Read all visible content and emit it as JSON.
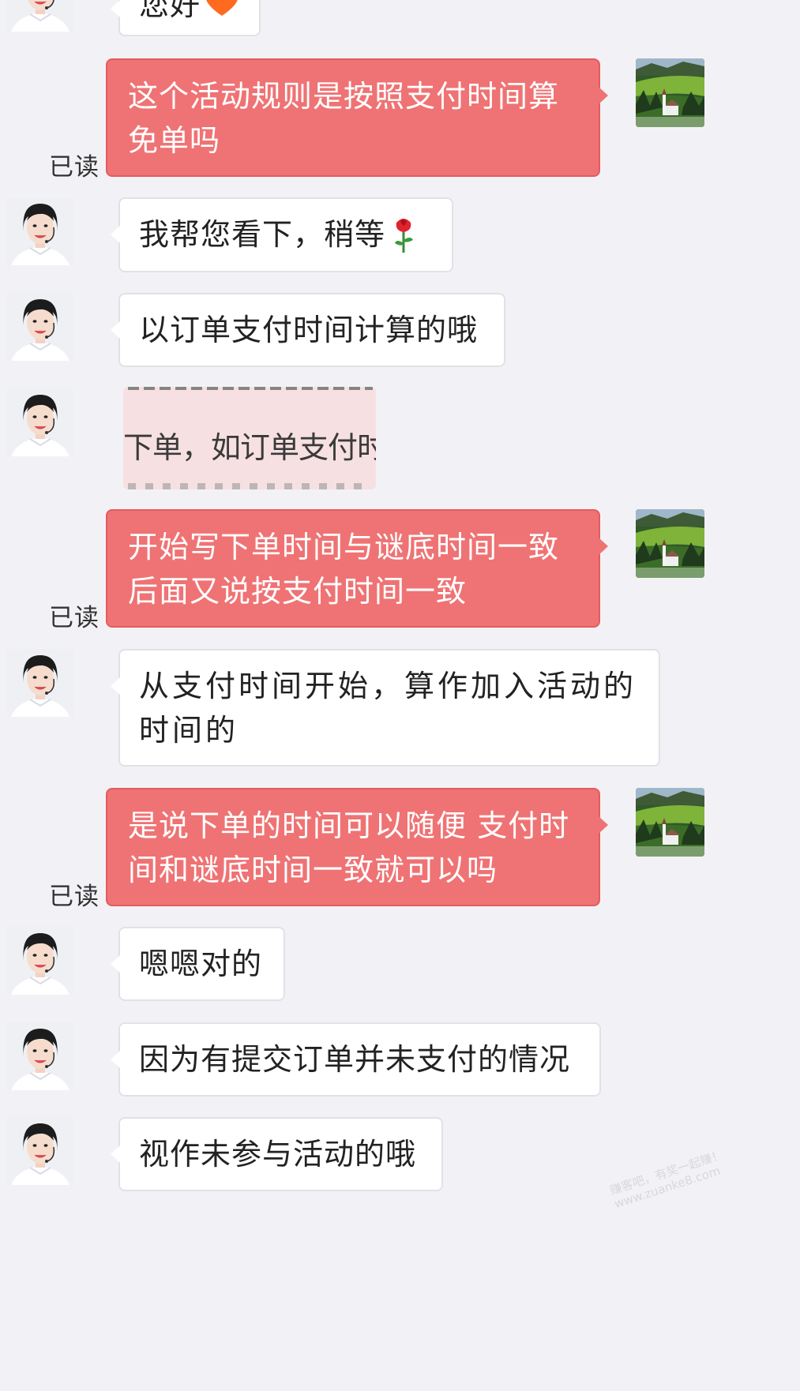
{
  "colors": {
    "background": "#f2f2f6",
    "outgoing_bubble": "#ef7374",
    "incoming_bubble": "#ffffff",
    "heart_emoji": "#ff6a1f"
  },
  "messages": [
    {
      "id": "m0",
      "side": "in",
      "text": "您好",
      "emoji": "orange-heart"
    },
    {
      "id": "m1",
      "side": "out",
      "text": "这个活动规则是按照支付时间算免单吗",
      "status": "已读"
    },
    {
      "id": "m2",
      "side": "in",
      "text": "我帮您看下，稍等",
      "emoji": "rose"
    },
    {
      "id": "m3",
      "side": "in",
      "text": "以订单支付时间计算的哦"
    },
    {
      "id": "m4",
      "side": "in",
      "type": "image",
      "text": "下单，如订单支付时间与"
    },
    {
      "id": "m5",
      "side": "out",
      "text": "开始写下单时间与谜底时间一致后面又说按支付时间一致",
      "status": "已读"
    },
    {
      "id": "m6",
      "side": "in",
      "text": "从支付时间开始，算作加入活动的时间的"
    },
    {
      "id": "m7",
      "side": "out",
      "text": "是说下单的时间可以随便 支付时间和谜底时间一致就可以吗",
      "status": "已读"
    },
    {
      "id": "m8",
      "side": "in",
      "text": "嗯嗯对的"
    },
    {
      "id": "m9",
      "side": "in",
      "text": "因为有提交订单并未支付的情况"
    },
    {
      "id": "m10",
      "side": "in",
      "text": "视作未参与活动的哦"
    }
  ],
  "watermark": {
    "line1": "赚客吧，有奖一起赚！",
    "line2": "www.zuanke8.com"
  }
}
